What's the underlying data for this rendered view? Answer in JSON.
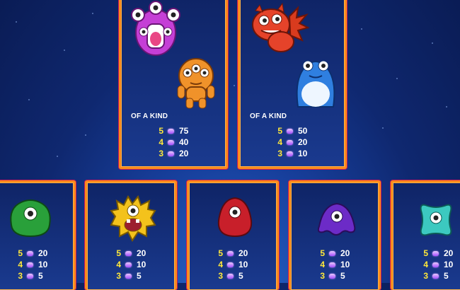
{
  "top_panels": [
    {
      "heading": "OF A KIND",
      "payouts": [
        {
          "count": "5",
          "value": "75"
        },
        {
          "count": "4",
          "value": "40"
        },
        {
          "count": "3",
          "value": "20"
        }
      ],
      "icons": [
        "purple-multi-eye-monster-icon",
        "orange-three-eye-monster-icon"
      ]
    },
    {
      "heading": "OF A KIND",
      "payouts": [
        {
          "count": "5",
          "value": "50"
        },
        {
          "count": "4",
          "value": "20"
        },
        {
          "count": "3",
          "value": "10"
        }
      ],
      "icons": [
        "red-spiky-monster-icon",
        "blue-frog-monster-icon"
      ]
    }
  ],
  "bottom_panels": [
    {
      "icon": "green-furry-monster-icon",
      "payouts": [
        {
          "count": "5",
          "value": "20"
        },
        {
          "count": "4",
          "value": "10"
        },
        {
          "count": "3",
          "value": "5"
        }
      ]
    },
    {
      "icon": "yellow-fuzzy-monster-icon",
      "payouts": [
        {
          "count": "5",
          "value": "20"
        },
        {
          "count": "4",
          "value": "10"
        },
        {
          "count": "3",
          "value": "5"
        }
      ]
    },
    {
      "icon": "red-blob-monster-icon",
      "payouts": [
        {
          "count": "5",
          "value": "20"
        },
        {
          "count": "4",
          "value": "10"
        },
        {
          "count": "3",
          "value": "5"
        }
      ]
    },
    {
      "icon": "purple-blob-monster-icon",
      "payouts": [
        {
          "count": "5",
          "value": "20"
        },
        {
          "count": "4",
          "value": "10"
        },
        {
          "count": "3",
          "value": "5"
        }
      ]
    },
    {
      "icon": "teal-blob-monster-icon",
      "payouts": [
        {
          "count": "5",
          "value": "20"
        },
        {
          "count": "4",
          "value": "10"
        },
        {
          "count": "3",
          "value": "5"
        }
      ]
    }
  ],
  "colors": {
    "frame": "#ff8a1c",
    "count_text": "#ffe83a",
    "value_text": "#ffffff",
    "gem": "#b46bff",
    "background": "#173f9c"
  }
}
